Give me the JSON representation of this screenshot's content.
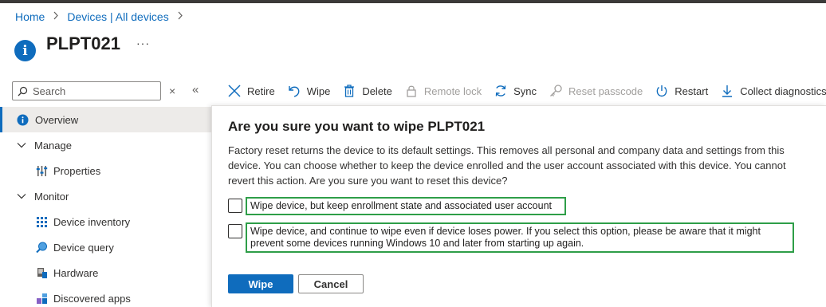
{
  "breadcrumb": {
    "home": "Home",
    "devices": "Devices | All devices"
  },
  "page": {
    "title": "PLPT021",
    "more": "···"
  },
  "search": {
    "placeholder": "Search",
    "clear": "×",
    "collapse": "«"
  },
  "sidebar": {
    "items": [
      {
        "label": "Overview",
        "icon": "info-icon",
        "active": true
      },
      {
        "label": "Manage",
        "icon": "chevron-down-icon"
      },
      {
        "label": "Properties",
        "icon": "properties-icon"
      },
      {
        "label": "Monitor",
        "icon": "chevron-down-icon"
      },
      {
        "label": "Device inventory",
        "icon": "device-inventory-icon"
      },
      {
        "label": "Device query",
        "icon": "device-query-icon"
      },
      {
        "label": "Hardware",
        "icon": "hardware-icon"
      },
      {
        "label": "Discovered apps",
        "icon": "discovered-apps-icon"
      }
    ]
  },
  "toolbar": {
    "retire": "Retire",
    "wipe": "Wipe",
    "delete": "Delete",
    "remote_lock": "Remote lock",
    "sync": "Sync",
    "reset_passcode": "Reset passcode",
    "restart": "Restart",
    "collect_diagnostics": "Collect diagnostics"
  },
  "dialog": {
    "title": "Are you sure you want to wipe PLPT021",
    "body": "Factory reset returns the device to its default settings. This removes all personal and company data and settings from this device. You can choose whether to keep the device enrolled and the user account associated with this device. You cannot revert this action. Are you sure you want to reset this device?",
    "option1": "Wipe device, but keep enrollment state and associated user account",
    "option2": "Wipe device, and continue to wipe even if device loses power. If you select this option, please be aware that it might prevent some devices running Windows 10 and later from starting up again.",
    "confirm": "Wipe",
    "cancel": "Cancel"
  },
  "colors": {
    "accent": "#0f6cbd",
    "highlight_border": "#2e9e48",
    "disabled": "#a19f9d"
  }
}
